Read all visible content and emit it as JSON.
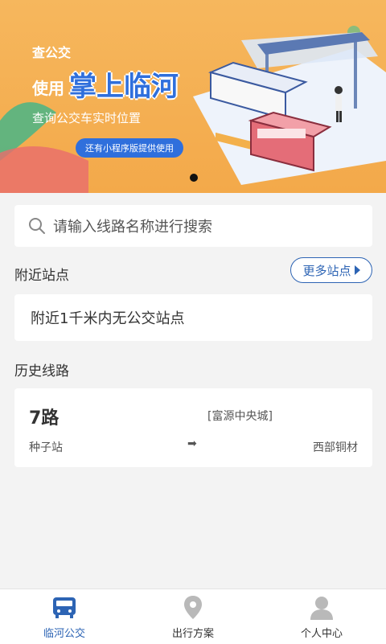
{
  "banner": {
    "small_title": "查公交",
    "use_text": "使用",
    "brand": "掌上临河",
    "subtitle": "查询公交车实时位置",
    "pill": "还有小程序版提供使用"
  },
  "search": {
    "placeholder": "请输入线路名称进行搜索"
  },
  "nearby": {
    "title": "附近站点",
    "more_label": "更多站点",
    "empty_text": "附近1千米内无公交站点"
  },
  "history": {
    "title": "历史线路",
    "routes": [
      {
        "name": "7路",
        "direction": "[富源中央城]",
        "from": "种子站",
        "arrow": "➡",
        "to": "西部铜材"
      }
    ]
  },
  "tabs": [
    {
      "label": "临河公交",
      "active": true
    },
    {
      "label": "出行方案",
      "active": false
    },
    {
      "label": "个人中心",
      "active": false
    }
  ],
  "colors": {
    "primary": "#2d64b4",
    "banner": "#f3a94a",
    "background": "#f3f3f3"
  }
}
